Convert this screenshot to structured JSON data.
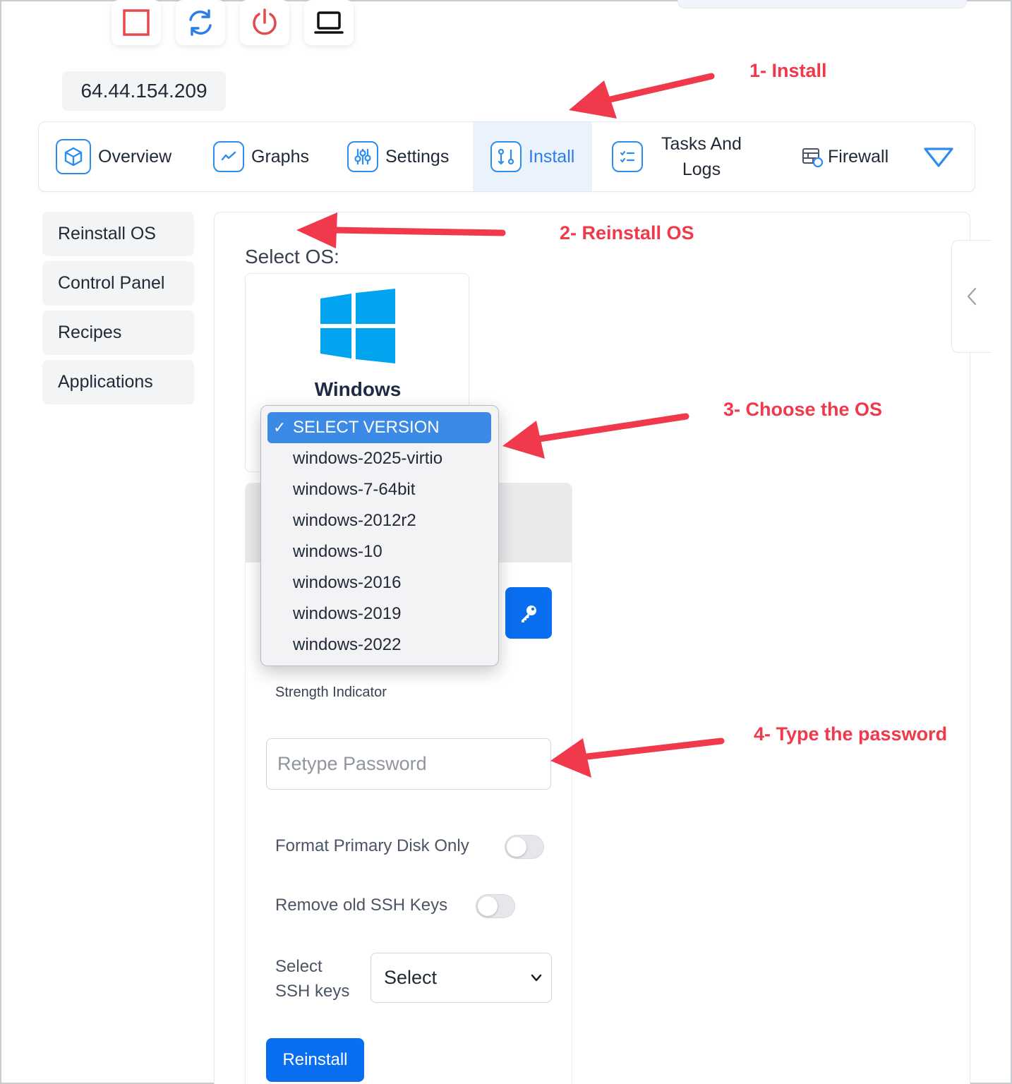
{
  "server": {
    "ip": "64.44.154.209"
  },
  "top_actions": [
    {
      "name": "stop",
      "icon": "stop-square-icon"
    },
    {
      "name": "restart",
      "icon": "refresh-icon"
    },
    {
      "name": "power",
      "icon": "power-icon"
    },
    {
      "name": "console",
      "icon": "laptop-icon"
    }
  ],
  "tabs": {
    "overview": "Overview",
    "graphs": "Graphs",
    "settings": "Settings",
    "install": "Install",
    "tasks_line1": "Tasks And",
    "tasks_line2": "Logs",
    "firewall": "Firewall",
    "active": "Install"
  },
  "sidebar": {
    "items": [
      "Reinstall OS",
      "Control Panel",
      "Recipes",
      "Applications"
    ]
  },
  "install": {
    "select_os_label": "Select OS:",
    "os_name": "Windows",
    "version_dropdown": {
      "selected": "SELECT VERSION",
      "options": [
        "windows-2025-virtio",
        "windows-7-64bit",
        "windows-2012r2",
        "windows-10",
        "windows-2016",
        "windows-2019",
        "windows-2022"
      ]
    },
    "strength_indicator": "Strength Indicator",
    "retype_placeholder": "Retype Password",
    "format_primary_disk_label": "Format Primary Disk Only",
    "format_primary_disk_on": false,
    "remove_ssh_keys_label": "Remove old SSH Keys",
    "remove_ssh_keys_on": false,
    "ssh_keys_label_line1": "Select",
    "ssh_keys_label_line2": "SSH keys",
    "ssh_keys_value": "Select",
    "reinstall_button": "Reinstall"
  },
  "annotations": {
    "a1": "1- Install",
    "a2": "2- Reinstall OS",
    "a3": "3- Choose the OS",
    "a4": "4- Type the password"
  },
  "colors": {
    "accent": "#0a6ef0",
    "annotation": "#f0394b",
    "windows_blue": "#00a4ef",
    "danger": "#e5484d"
  }
}
